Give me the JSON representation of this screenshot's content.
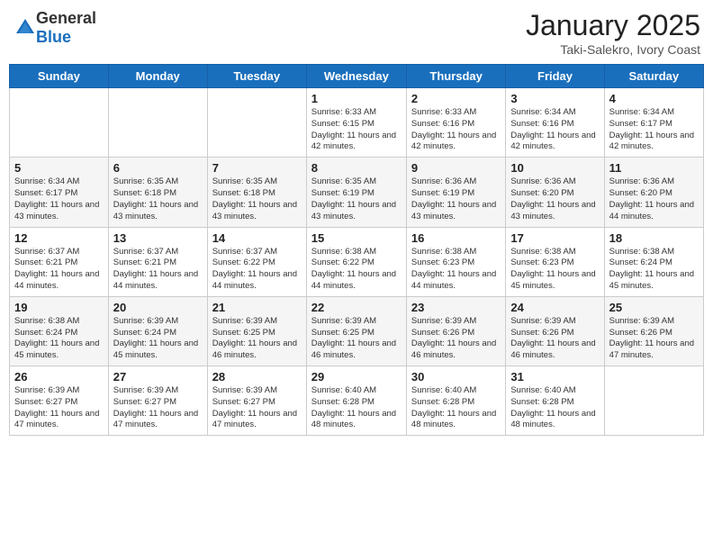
{
  "header": {
    "logo_general": "General",
    "logo_blue": "Blue",
    "month_title": "January 2025",
    "location": "Taki-Salekro, Ivory Coast"
  },
  "weekdays": [
    "Sunday",
    "Monday",
    "Tuesday",
    "Wednesday",
    "Thursday",
    "Friday",
    "Saturday"
  ],
  "weeks": [
    [
      {
        "day": "",
        "sunrise": "",
        "sunset": "",
        "daylight": ""
      },
      {
        "day": "",
        "sunrise": "",
        "sunset": "",
        "daylight": ""
      },
      {
        "day": "",
        "sunrise": "",
        "sunset": "",
        "daylight": ""
      },
      {
        "day": "1",
        "sunrise": "Sunrise: 6:33 AM",
        "sunset": "Sunset: 6:15 PM",
        "daylight": "Daylight: 11 hours and 42 minutes."
      },
      {
        "day": "2",
        "sunrise": "Sunrise: 6:33 AM",
        "sunset": "Sunset: 6:16 PM",
        "daylight": "Daylight: 11 hours and 42 minutes."
      },
      {
        "day": "3",
        "sunrise": "Sunrise: 6:34 AM",
        "sunset": "Sunset: 6:16 PM",
        "daylight": "Daylight: 11 hours and 42 minutes."
      },
      {
        "day": "4",
        "sunrise": "Sunrise: 6:34 AM",
        "sunset": "Sunset: 6:17 PM",
        "daylight": "Daylight: 11 hours and 42 minutes."
      }
    ],
    [
      {
        "day": "5",
        "sunrise": "Sunrise: 6:34 AM",
        "sunset": "Sunset: 6:17 PM",
        "daylight": "Daylight: 11 hours and 43 minutes."
      },
      {
        "day": "6",
        "sunrise": "Sunrise: 6:35 AM",
        "sunset": "Sunset: 6:18 PM",
        "daylight": "Daylight: 11 hours and 43 minutes."
      },
      {
        "day": "7",
        "sunrise": "Sunrise: 6:35 AM",
        "sunset": "Sunset: 6:18 PM",
        "daylight": "Daylight: 11 hours and 43 minutes."
      },
      {
        "day": "8",
        "sunrise": "Sunrise: 6:35 AM",
        "sunset": "Sunset: 6:19 PM",
        "daylight": "Daylight: 11 hours and 43 minutes."
      },
      {
        "day": "9",
        "sunrise": "Sunrise: 6:36 AM",
        "sunset": "Sunset: 6:19 PM",
        "daylight": "Daylight: 11 hours and 43 minutes."
      },
      {
        "day": "10",
        "sunrise": "Sunrise: 6:36 AM",
        "sunset": "Sunset: 6:20 PM",
        "daylight": "Daylight: 11 hours and 43 minutes."
      },
      {
        "day": "11",
        "sunrise": "Sunrise: 6:36 AM",
        "sunset": "Sunset: 6:20 PM",
        "daylight": "Daylight: 11 hours and 44 minutes."
      }
    ],
    [
      {
        "day": "12",
        "sunrise": "Sunrise: 6:37 AM",
        "sunset": "Sunset: 6:21 PM",
        "daylight": "Daylight: 11 hours and 44 minutes."
      },
      {
        "day": "13",
        "sunrise": "Sunrise: 6:37 AM",
        "sunset": "Sunset: 6:21 PM",
        "daylight": "Daylight: 11 hours and 44 minutes."
      },
      {
        "day": "14",
        "sunrise": "Sunrise: 6:37 AM",
        "sunset": "Sunset: 6:22 PM",
        "daylight": "Daylight: 11 hours and 44 minutes."
      },
      {
        "day": "15",
        "sunrise": "Sunrise: 6:38 AM",
        "sunset": "Sunset: 6:22 PM",
        "daylight": "Daylight: 11 hours and 44 minutes."
      },
      {
        "day": "16",
        "sunrise": "Sunrise: 6:38 AM",
        "sunset": "Sunset: 6:23 PM",
        "daylight": "Daylight: 11 hours and 44 minutes."
      },
      {
        "day": "17",
        "sunrise": "Sunrise: 6:38 AM",
        "sunset": "Sunset: 6:23 PM",
        "daylight": "Daylight: 11 hours and 45 minutes."
      },
      {
        "day": "18",
        "sunrise": "Sunrise: 6:38 AM",
        "sunset": "Sunset: 6:24 PM",
        "daylight": "Daylight: 11 hours and 45 minutes."
      }
    ],
    [
      {
        "day": "19",
        "sunrise": "Sunrise: 6:38 AM",
        "sunset": "Sunset: 6:24 PM",
        "daylight": "Daylight: 11 hours and 45 minutes."
      },
      {
        "day": "20",
        "sunrise": "Sunrise: 6:39 AM",
        "sunset": "Sunset: 6:24 PM",
        "daylight": "Daylight: 11 hours and 45 minutes."
      },
      {
        "day": "21",
        "sunrise": "Sunrise: 6:39 AM",
        "sunset": "Sunset: 6:25 PM",
        "daylight": "Daylight: 11 hours and 46 minutes."
      },
      {
        "day": "22",
        "sunrise": "Sunrise: 6:39 AM",
        "sunset": "Sunset: 6:25 PM",
        "daylight": "Daylight: 11 hours and 46 minutes."
      },
      {
        "day": "23",
        "sunrise": "Sunrise: 6:39 AM",
        "sunset": "Sunset: 6:26 PM",
        "daylight": "Daylight: 11 hours and 46 minutes."
      },
      {
        "day": "24",
        "sunrise": "Sunrise: 6:39 AM",
        "sunset": "Sunset: 6:26 PM",
        "daylight": "Daylight: 11 hours and 46 minutes."
      },
      {
        "day": "25",
        "sunrise": "Sunrise: 6:39 AM",
        "sunset": "Sunset: 6:26 PM",
        "daylight": "Daylight: 11 hours and 47 minutes."
      }
    ],
    [
      {
        "day": "26",
        "sunrise": "Sunrise: 6:39 AM",
        "sunset": "Sunset: 6:27 PM",
        "daylight": "Daylight: 11 hours and 47 minutes."
      },
      {
        "day": "27",
        "sunrise": "Sunrise: 6:39 AM",
        "sunset": "Sunset: 6:27 PM",
        "daylight": "Daylight: 11 hours and 47 minutes."
      },
      {
        "day": "28",
        "sunrise": "Sunrise: 6:39 AM",
        "sunset": "Sunset: 6:27 PM",
        "daylight": "Daylight: 11 hours and 47 minutes."
      },
      {
        "day": "29",
        "sunrise": "Sunrise: 6:40 AM",
        "sunset": "Sunset: 6:28 PM",
        "daylight": "Daylight: 11 hours and 48 minutes."
      },
      {
        "day": "30",
        "sunrise": "Sunrise: 6:40 AM",
        "sunset": "Sunset: 6:28 PM",
        "daylight": "Daylight: 11 hours and 48 minutes."
      },
      {
        "day": "31",
        "sunrise": "Sunrise: 6:40 AM",
        "sunset": "Sunset: 6:28 PM",
        "daylight": "Daylight: 11 hours and 48 minutes."
      },
      {
        "day": "",
        "sunrise": "",
        "sunset": "",
        "daylight": ""
      }
    ]
  ]
}
